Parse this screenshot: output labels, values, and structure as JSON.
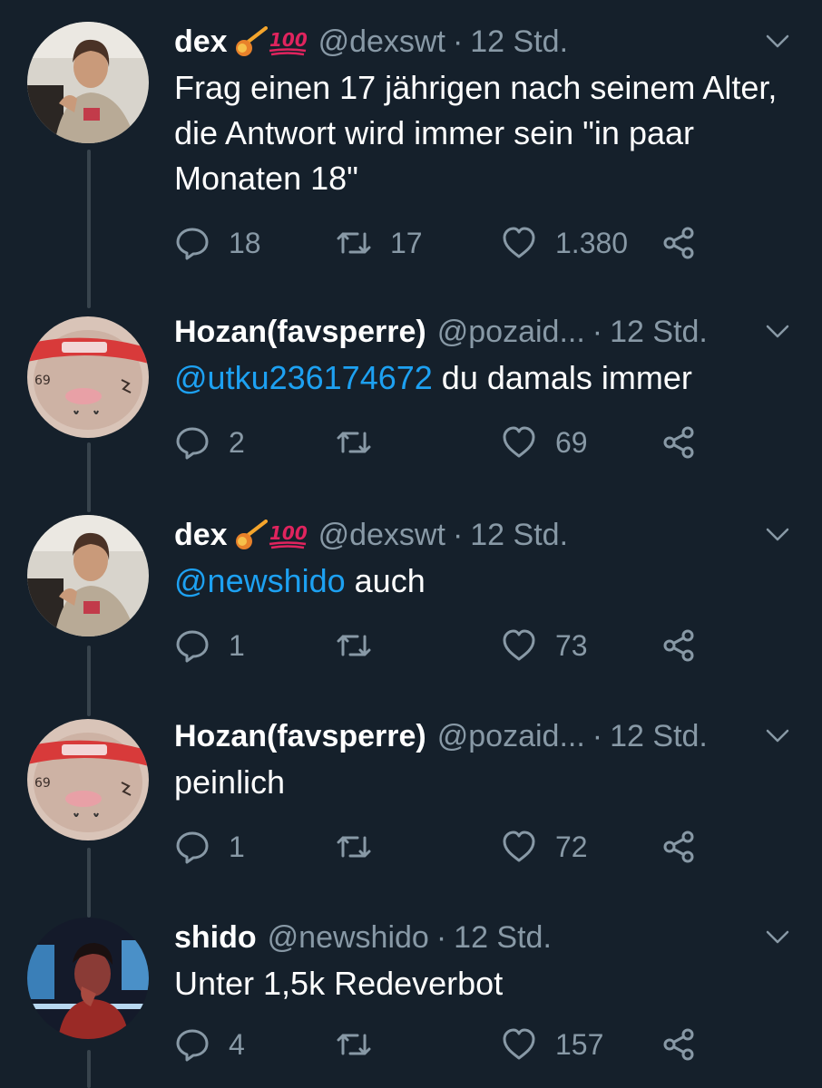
{
  "tweets": [
    {
      "name": "dex",
      "has_emoji": true,
      "handle": "@dexswt",
      "dot": "·",
      "time": "12 Std.",
      "mention": "",
      "text": "Frag einen 17 jährigen nach seinem Alter, die Antwort wird immer sein \"in paar Monaten 18\"",
      "replies": "18",
      "retweets": "17",
      "likes": "1.380"
    },
    {
      "name": "Hozan(favsperre)",
      "has_emoji": false,
      "handle": "@pozaid...",
      "dot": "·",
      "time": "12 Std.",
      "mention": "@utku236174672",
      "text": " du damals immer",
      "replies": "2",
      "retweets": "",
      "likes": "69"
    },
    {
      "name": "dex",
      "has_emoji": true,
      "handle": "@dexswt",
      "dot": "·",
      "time": "12 Std.",
      "mention": "@newshido",
      "text": " auch",
      "replies": "1",
      "retweets": "",
      "likes": "73"
    },
    {
      "name": "Hozan(favsperre)",
      "has_emoji": false,
      "handle": "@pozaid...",
      "dot": "·",
      "time": "12 Std.",
      "mention": "",
      "text": "peinlich",
      "replies": "1",
      "retweets": "",
      "likes": "72"
    },
    {
      "name": "shido",
      "has_emoji": false,
      "handle": "@newshido",
      "dot": "·",
      "time": "12 Std.",
      "mention": "",
      "text": "Unter 1,5k Redeverbot",
      "replies": "4",
      "retweets": "",
      "likes": "157"
    }
  ],
  "icons": {
    "reply": "reply-icon",
    "retweet": "retweet-icon",
    "like": "heart-icon",
    "share": "share-icon",
    "menu": "chevron-down-icon",
    "emoji": [
      "comet-emoji-icon",
      "hundred-points-emoji-icon"
    ]
  },
  "colors": {
    "background": "#15202b",
    "text": "#ffffff",
    "secondary": "#8899a6",
    "link": "#1da1f2",
    "thread_line": "#38444d"
  }
}
